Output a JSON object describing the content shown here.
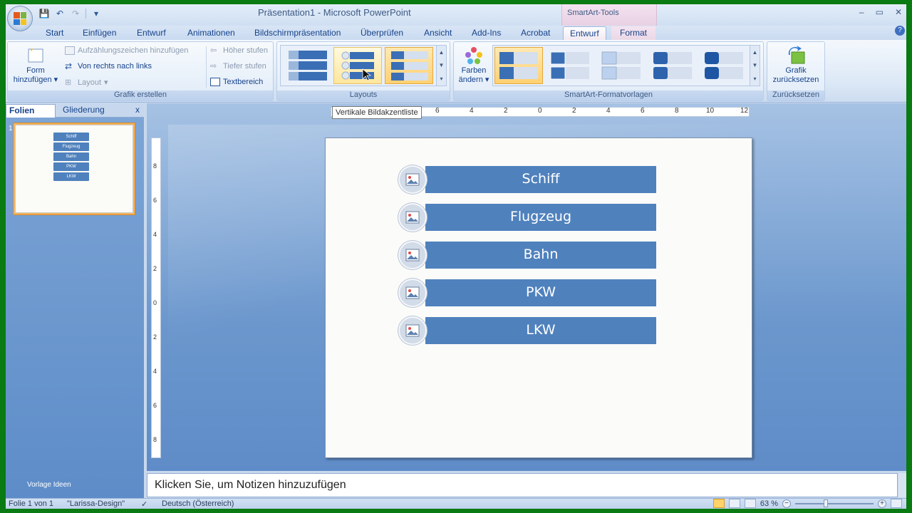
{
  "window": {
    "title": "Präsentation1 - Microsoft PowerPoint",
    "context_tab_header": "SmartArt-Tools",
    "controls": [
      "–",
      "▭",
      "✕"
    ]
  },
  "quick_access": {
    "save": "💾",
    "undo": "↶",
    "redo": "↷",
    "more": "▾"
  },
  "tabs": [
    {
      "label": "Start"
    },
    {
      "label": "Einfügen"
    },
    {
      "label": "Entwurf"
    },
    {
      "label": "Animationen"
    },
    {
      "label": "Bildschirmpräsentation"
    },
    {
      "label": "Überprüfen"
    },
    {
      "label": "Ansicht"
    },
    {
      "label": "Add-Ins"
    },
    {
      "label": "Acrobat"
    },
    {
      "label": "Entwurf",
      "active": true
    },
    {
      "label": "Format"
    }
  ],
  "ribbon": {
    "grafik_erstellen": {
      "label": "Grafik erstellen",
      "form_hinzufuegen_1": "Form",
      "form_hinzufuegen_2": "hinzufügen",
      "aufzaehlung": "Aufzählungszeichen hinzufügen",
      "rechts_links": "Von rechts nach links",
      "layout": "Layout",
      "hoeher": "Höher stufen",
      "tiefer": "Tiefer stufen",
      "textbereich": "Textbereich"
    },
    "layouts": {
      "label": "Layouts",
      "tooltip": "Vertikale Bildakzentliste"
    },
    "formatvorlagen": {
      "label": "SmartArt-Formatvorlagen",
      "farben_1": "Farben",
      "farben_2": "ändern"
    },
    "zuruecksetzen": {
      "label": "Zurücksetzen",
      "grafik_1": "Grafik",
      "grafik_2": "zurücksetzen"
    }
  },
  "left_pane": {
    "tab_folien": "Folien",
    "tab_gliederung": "Gliederung",
    "close": "x",
    "slide_number": "1",
    "footer": "Vorlage Ideen"
  },
  "slide": {
    "items": [
      "Schiff",
      "Flugzeug",
      "Bahn",
      "PKW",
      "LKW"
    ]
  },
  "ruler": {
    "h_labels": [
      "6",
      "4",
      "2",
      "0",
      "2",
      "4",
      "6",
      "8",
      "10",
      "12"
    ],
    "v_labels": [
      "8",
      "6",
      "4",
      "2",
      "0",
      "2",
      "4",
      "6",
      "8"
    ]
  },
  "notes": {
    "placeholder": "Klicken Sie, um  Notizen hinzuzufügen"
  },
  "status": {
    "slide": "Folie 1 von 1",
    "design": "\"Larissa-Design\"",
    "language": "Deutsch (Österreich)",
    "zoom": "63 %"
  },
  "colors": {
    "smartart_blue": "#4f81bd",
    "ribbon_text": "#15428b",
    "frame_green": "#0a7a12"
  }
}
